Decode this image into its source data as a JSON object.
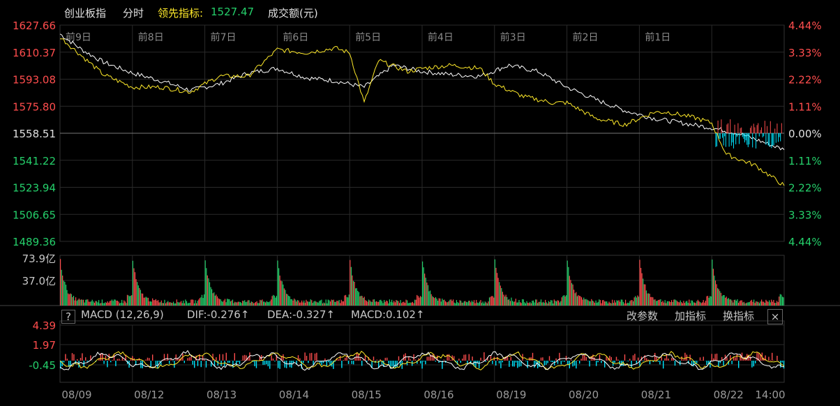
{
  "header": {
    "index_name": "创业板指",
    "period": "分时",
    "leader_label": "领先指标:",
    "leader_value": "1527.47",
    "volume_label": "成交额(元)"
  },
  "colors": {
    "up": "#ff4d4d",
    "down": "#25d06b",
    "price_line": "#ffffff",
    "leader_line": "#ffea2a",
    "grid": "#2a2a2a",
    "macd_down": "#00e5ff"
  },
  "chart_data": [
    {
      "type": "line",
      "name": "price",
      "day_labels": [
        "前9日",
        "前8日",
        "前7日",
        "前6日",
        "前5日",
        "前4日",
        "前3日",
        "前2日",
        "前1日"
      ],
      "y_ticks_left": [
        "1627.66",
        "1610.37",
        "1593.08",
        "1575.80",
        "1558.51",
        "1541.22",
        "1523.94",
        "1506.65",
        "1489.36"
      ],
      "y_ticks_right": [
        "4.44%",
        "3.33%",
        "2.22%",
        "1.11%",
        "0.00%",
        "1.11%",
        "2.22%",
        "3.33%",
        "4.44%"
      ],
      "ylim": [
        1489.36,
        1627.66
      ],
      "base": 1558.51,
      "series": [
        {
          "name": "",
          "color": "white",
          "points": [
            [
              0,
              1622
            ],
            [
              0.3,
              1612
            ],
            [
              0.6,
              1604
            ],
            [
              1.0,
              1597
            ],
            [
              1.4,
              1592
            ],
            [
              1.8,
              1586
            ],
            [
              2.2,
              1590
            ],
            [
              2.6,
              1597
            ],
            [
              3.0,
              1600
            ],
            [
              3.4,
              1594
            ],
            [
              3.8,
              1592
            ],
            [
              4.2,
              1588
            ],
            [
              4.6,
              1602
            ],
            [
              5.0,
              1598
            ],
            [
              5.4,
              1596
            ],
            [
              5.8,
              1595
            ],
            [
              6.2,
              1602
            ],
            [
              6.6,
              1598
            ],
            [
              7.0,
              1588
            ],
            [
              7.4,
              1580
            ],
            [
              7.8,
              1573
            ],
            [
              8.2,
              1568
            ],
            [
              8.6,
              1565
            ],
            [
              9.0,
              1562
            ],
            [
              9.4,
              1558
            ],
            [
              10.0,
              1548
            ]
          ]
        },
        {
          "name": "",
          "color": "yellow",
          "points": [
            [
              0,
              1620
            ],
            [
              0.3,
              1608
            ],
            [
              0.6,
              1596
            ],
            [
              1.0,
              1588
            ],
            [
              1.4,
              1588
            ],
            [
              1.8,
              1585
            ],
            [
              2.2,
              1595
            ],
            [
              2.6,
              1595
            ],
            [
              3.0,
              1612
            ],
            [
              3.4,
              1610
            ],
            [
              3.8,
              1613
            ],
            [
              4.0,
              1610
            ],
            [
              4.2,
              1578
            ],
            [
              4.4,
              1605
            ],
            [
              4.8,
              1598
            ],
            [
              5.0,
              1600
            ],
            [
              5.4,
              1602
            ],
            [
              5.8,
              1600
            ],
            [
              6.0,
              1590
            ],
            [
              6.4,
              1582
            ],
            [
              6.8,
              1578
            ],
            [
              7.0,
              1578
            ],
            [
              7.4,
              1568
            ],
            [
              7.8,
              1564
            ],
            [
              8.2,
              1572
            ],
            [
              8.4,
              1572
            ],
            [
              8.8,
              1568
            ],
            [
              9.0,
              1565
            ],
            [
              9.2,
              1545
            ],
            [
              9.6,
              1538
            ],
            [
              10.0,
              1525
            ]
          ]
        }
      ]
    },
    {
      "type": "bar",
      "name": "volume",
      "y_ticks": [
        "73.9亿",
        "37.0亿"
      ],
      "ylim": [
        0,
        73.9
      ],
      "note": "daily spikes at each session open"
    },
    {
      "type": "line",
      "name": "MACD",
      "panel_title": "MACD (12,26,9)",
      "dif_label": "DIF:-0.276↑",
      "dea_label": "DEA:-0.327↑",
      "macd_label": "MACD:0.102↑",
      "y_ticks": [
        "4.39",
        "1.97",
        "-0.45"
      ],
      "x_ticks": [
        "08/09",
        "08/12",
        "08/13",
        "08/14",
        "08/15",
        "08/16",
        "08/19",
        "08/20",
        "08/21",
        "08/22",
        "14:00"
      ]
    }
  ],
  "controls": {
    "help": "?",
    "change_params": "改参数",
    "add_indicator": "加指标",
    "switch_indicator": "换指标",
    "close": "×"
  }
}
